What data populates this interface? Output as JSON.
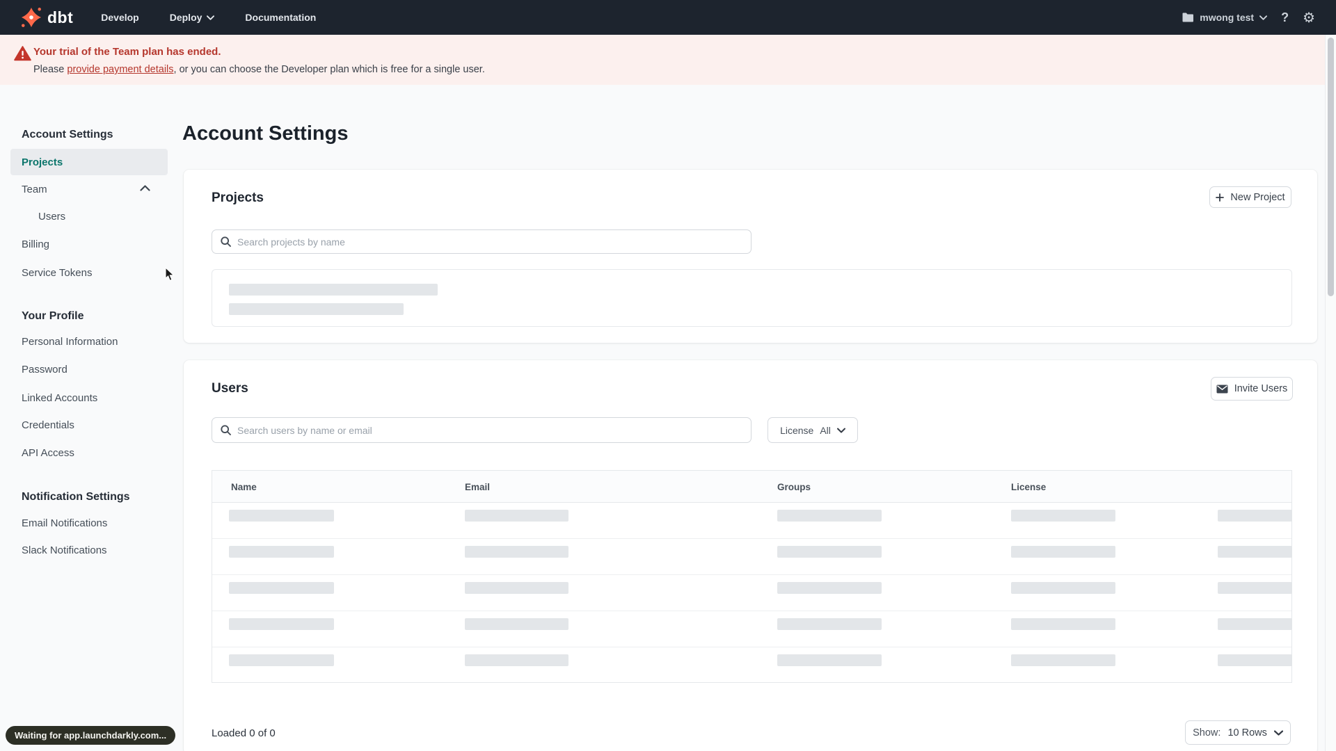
{
  "colors": {
    "nav_bg": "#1d242e",
    "brand_orange": "#ff694a",
    "active_teal": "#0b756b",
    "banner_bg": "#fcf0ee",
    "banner_red": "#b5372d",
    "skeleton": "#e3e6e9"
  },
  "nav": {
    "brand": "dbt",
    "items": [
      {
        "label": "Develop"
      },
      {
        "label": "Deploy"
      },
      {
        "label": "Documentation"
      }
    ],
    "account": "mwong test"
  },
  "banner": {
    "title": "Your trial of the Team plan has ended.",
    "body_prefix": "Please ",
    "link_text": "provide payment details",
    "body_suffix": ", or you can choose the Developer plan which is free for a single user."
  },
  "sidebar": {
    "sections": [
      {
        "title": "Account Settings",
        "items": [
          {
            "label": "Projects",
            "active": true
          },
          {
            "label": "Team"
          },
          {
            "label": "Users"
          },
          {
            "label": "Billing"
          },
          {
            "label": "Service Tokens"
          }
        ]
      },
      {
        "title": "Your Profile",
        "items": [
          {
            "label": "Personal Information"
          },
          {
            "label": "Password"
          },
          {
            "label": "Linked Accounts"
          },
          {
            "label": "Credentials"
          },
          {
            "label": "API Access"
          }
        ]
      },
      {
        "title": "Notification Settings",
        "items": [
          {
            "label": "Email Notifications"
          },
          {
            "label": "Slack Notifications"
          }
        ]
      }
    ]
  },
  "main": {
    "page_title": "Account Settings"
  },
  "projects": {
    "title": "Projects",
    "new_button": "New Project",
    "search_placeholder": "Search projects by name"
  },
  "users": {
    "title": "Users",
    "invite_button": "Invite Users",
    "search_placeholder": "Search users by name or email",
    "license_label": "License",
    "license_value": "All",
    "table_headers": [
      "Name",
      "Email",
      "Groups",
      "License"
    ],
    "loaded_text": "Loaded 0 of 0",
    "show_label": "Show:",
    "show_value": "10 Rows"
  },
  "statusbar": {
    "text": "Waiting for app.launchdarkly.com..."
  }
}
